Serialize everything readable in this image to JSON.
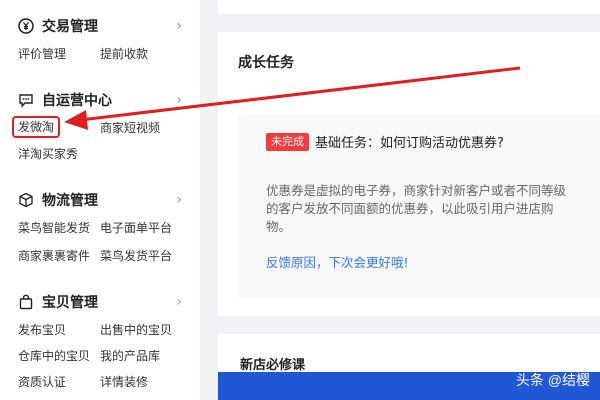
{
  "sidebar": {
    "sections": [
      {
        "title": "交易管理",
        "icon": "yen-circle-icon",
        "links": [
          "评价管理",
          "提前收款"
        ]
      },
      {
        "title": "自运营中心",
        "icon": "chat-bubble-icon",
        "links": [
          "发微淘",
          "商家短视频",
          "洋淘买家秀"
        ]
      },
      {
        "title": "物流管理",
        "icon": "cube-icon",
        "links": [
          "菜鸟智能发货",
          "电子面单平台",
          "商家裹裹寄件",
          "菜鸟发货平台"
        ]
      },
      {
        "title": "宝贝管理",
        "icon": "bag-icon",
        "links": [
          "发布宝贝",
          "出售中的宝贝",
          "仓库中的宝贝",
          "我的产品库",
          "资质认证",
          "详情装修"
        ]
      }
    ]
  },
  "growth": {
    "title": "成长任务",
    "badge": "未完成",
    "task_title": "基础任务：如何订购活动优惠券?",
    "description": "优惠券是虚拟的电子券，商家针对新客户或者不同等级的客户发放不同面额的优惠券，以此吸引用户进店购物。",
    "feedback": "反馈原因，下次会更好哦!"
  },
  "course": {
    "title": "新店必修课"
  },
  "watermark": "头条 @结樱",
  "colors": {
    "accent_blue": "#3478f6",
    "badge_red": "#f03c3c",
    "highlight_red": "#e02020",
    "course_bar": "#1f57d6"
  }
}
